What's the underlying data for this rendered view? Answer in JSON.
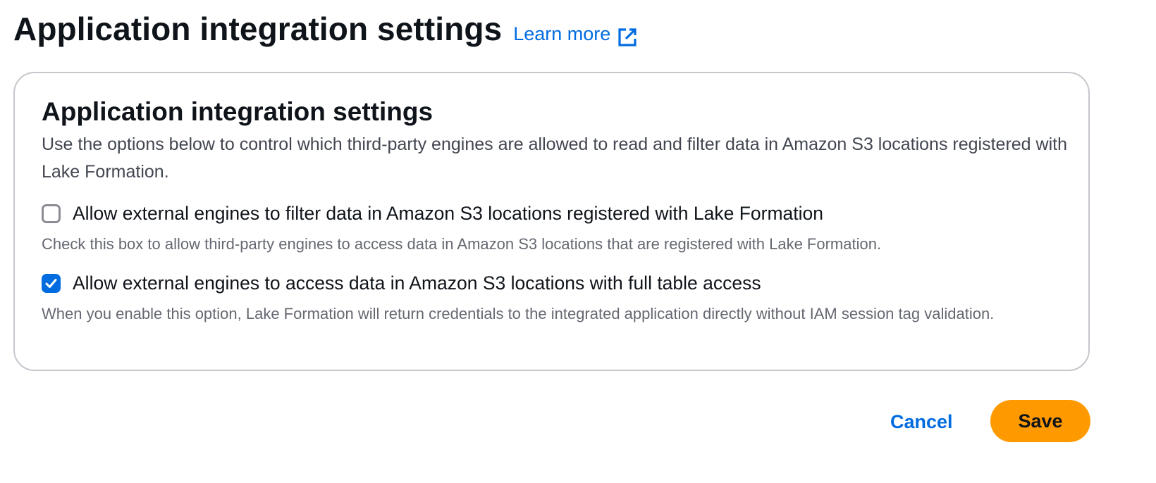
{
  "header": {
    "title": "Application integration settings",
    "learn_more": "Learn more",
    "learn_more_icon": "external-link-icon"
  },
  "panel": {
    "title": "Application integration settings",
    "description": "Use the options below to control which third-party engines are allowed to read and filter data in Amazon S3 locations registered with Lake Formation.",
    "options": [
      {
        "label": "Allow external engines to filter data in Amazon S3 locations registered with Lake Formation",
        "description": "Check this box to allow third-party engines to access data in Amazon S3 locations that are registered with Lake Formation.",
        "checked": false
      },
      {
        "label": "Allow external engines to access data in Amazon S3 locations with full table access",
        "description": "When you enable this option, Lake Formation will return credentials to the integrated application directly without IAM session tag validation.",
        "checked": true
      }
    ]
  },
  "footer": {
    "cancel_label": "Cancel",
    "save_label": "Save"
  },
  "colors": {
    "link": "#006ce0",
    "primary_button": "#ff9900",
    "checkbox_checked": "#006ce0",
    "border": "#c6c6cd"
  }
}
